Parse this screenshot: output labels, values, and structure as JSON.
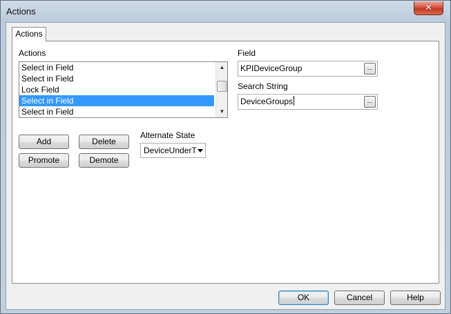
{
  "window": {
    "title": "Actions",
    "close_glyph": "✕"
  },
  "tab": {
    "label": "Actions"
  },
  "actions_list": {
    "label": "Actions",
    "items": [
      "Select in Field",
      "Select in Field",
      "Lock Field",
      "Select in Field",
      "Select in Field"
    ],
    "selected_index": 3
  },
  "field": {
    "label": "Field",
    "value": "KPIDeviceGroup"
  },
  "search_string": {
    "label": "Search String",
    "value": "DeviceGroups"
  },
  "alternate_state": {
    "label": "Alternate State",
    "value": "DeviceUnderT"
  },
  "buttons": {
    "add": "Add",
    "delete": "Delete",
    "promote": "Promote",
    "demote": "Demote",
    "browse": "...",
    "ok": "OK",
    "cancel": "Cancel",
    "help": "Help"
  },
  "scrollbar": {
    "up_glyph": "▲",
    "down_glyph": "▼"
  },
  "colors": {
    "selection": "#3399ff",
    "close_button": "#c7432b"
  }
}
